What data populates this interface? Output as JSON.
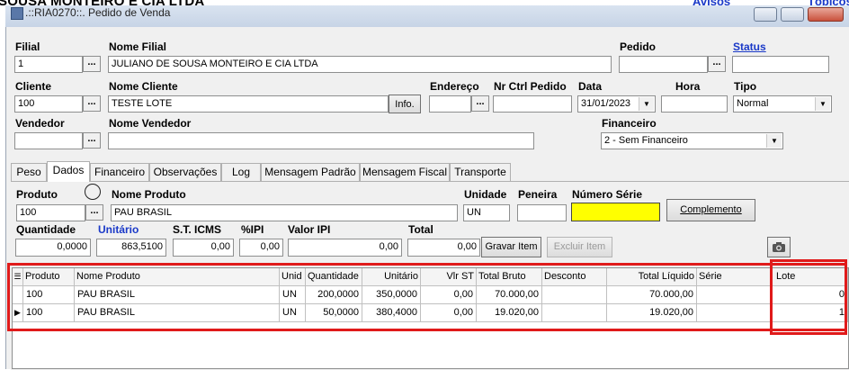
{
  "top": {
    "company_name": "SOUSA MONTEIRO E CIA LTDA",
    "link_avisos": "Avisos",
    "link_topicos": "Tópicos"
  },
  "window": {
    "title": ".::RIA0270::. Pedido de Venda"
  },
  "form": {
    "filial_label": "Filial",
    "filial_value": "1",
    "nome_filial_label": "Nome Filial",
    "nome_filial_value": "JULIANO DE SOUSA MONTEIRO E CIA LTDA",
    "pedido_label": "Pedido",
    "pedido_value": "",
    "status_label": "Status",
    "status_value": "",
    "cliente_label": "Cliente",
    "cliente_value": "100",
    "nome_cliente_label": "Nome Cliente",
    "nome_cliente_value": "TESTE LOTE",
    "info_button": "Info.",
    "endereco_label": "Endereço",
    "endereco_value": "",
    "nr_ctrl_label": "Nr Ctrl Pedido",
    "nr_ctrl_value": "",
    "data_label": "Data",
    "data_value": "31/01/2023",
    "hora_label": "Hora",
    "hora_value": "",
    "tipo_label": "Tipo",
    "tipo_value": "Normal",
    "vendedor_label": "Vendedor",
    "vendedor_value": "",
    "nome_vendedor_label": "Nome Vendedor",
    "nome_vendedor_value": "",
    "financeiro_label": "Financeiro",
    "financeiro_value": "2 - Sem Financeiro",
    "ellipsis": "..."
  },
  "tabs": [
    "Peso",
    "Dados",
    "Financeiro",
    "Observações",
    "Log",
    "Mensagem Padrão",
    "Mensagem Fiscal",
    "Transporte"
  ],
  "item": {
    "produto_label": "Produto",
    "produto_value": "100",
    "nome_produto_label": "Nome Produto",
    "nome_produto_value": "PAU BRASIL",
    "unidade_label": "Unidade",
    "unidade_value": "UN",
    "peneira_label": "Peneira",
    "peneira_value": "",
    "numero_serie_label": "Número Série",
    "numero_serie_value": "",
    "complemento_button": "Complemento",
    "quantidade_label": "Quantidade",
    "quantidade_value": "0,0000",
    "unitario_label": "Unitário",
    "unitario_value": "863,5100",
    "st_icms_label": "S.T. ICMS",
    "st_icms_value": "0,00",
    "ipi_pct_label": "%IPI",
    "ipi_pct_value": "0,00",
    "valor_ipi_label": "Valor IPI",
    "valor_ipi_value": "0,00",
    "total_label": "Total",
    "total_value": "0,00",
    "gravar_button": "Gravar Item",
    "excluir_button": "Excluir Item"
  },
  "grid": {
    "headers": [
      "Produto",
      "Nome Produto",
      "Unid",
      "Quantidade",
      "Unitário",
      "Vlr ST",
      "Total Bruto",
      "Desconto",
      "Total Líquido",
      "Série",
      "Lote"
    ],
    "rows": [
      [
        "100",
        "PAU BRASIL",
        "UN",
        "200,0000",
        "350,0000",
        "0,00",
        "70.000,00",
        "",
        "70.000,00",
        "",
        "0"
      ],
      [
        "100",
        "PAU BRASIL",
        "UN",
        "50,0000",
        "380,4000",
        "0,00",
        "19.020,00",
        "",
        "19.020,00",
        "",
        "1"
      ]
    ]
  },
  "colors": {
    "highlight_border": "#e01a1a",
    "serie_field": "#ffff00",
    "link_blue": "#1a39c8"
  }
}
